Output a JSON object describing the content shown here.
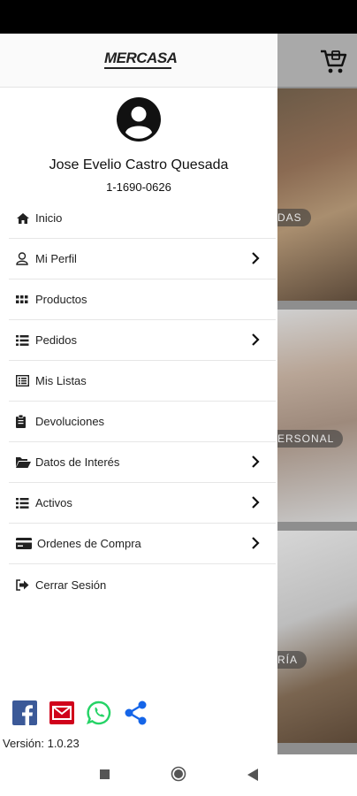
{
  "drawer": {
    "logo_text": "MERCASA",
    "user": {
      "name": "Jose Evelio Castro Quesada",
      "id": "1-1690-0626"
    },
    "menu": [
      {
        "label": "Inicio",
        "icon": "home-icon",
        "has_chevron": false
      },
      {
        "label": "Mi Perfil",
        "icon": "user-icon",
        "has_chevron": true
      },
      {
        "label": "Productos",
        "icon": "grid-icon",
        "has_chevron": false
      },
      {
        "label": "Pedidos",
        "icon": "list-icon",
        "has_chevron": true
      },
      {
        "label": "Mis Listas",
        "icon": "list-alt-icon",
        "has_chevron": false
      },
      {
        "label": "Devoluciones",
        "icon": "clipboard-icon",
        "has_chevron": false
      },
      {
        "label": "Datos de Interés",
        "icon": "folder-open-icon",
        "has_chevron": true
      },
      {
        "label": "Activos",
        "icon": "list-icon",
        "has_chevron": true
      },
      {
        "label": "Ordenes de Compra",
        "icon": "credit-card-icon",
        "has_chevron": true
      },
      {
        "label": "Cerrar Sesión",
        "icon": "sign-out-icon",
        "has_chevron": false
      }
    ],
    "share": [
      "facebook-icon",
      "email-icon",
      "whatsapp-icon",
      "share-icon"
    ],
    "version": "Versión: 1.0.23"
  },
  "background": {
    "card_labels": [
      "DAS",
      "ERSONAL",
      "RÍA"
    ]
  },
  "colors": {
    "facebook": "#3b5998",
    "email": "#d0021b",
    "whatsapp": "#25d366",
    "share": "#1565e8"
  }
}
